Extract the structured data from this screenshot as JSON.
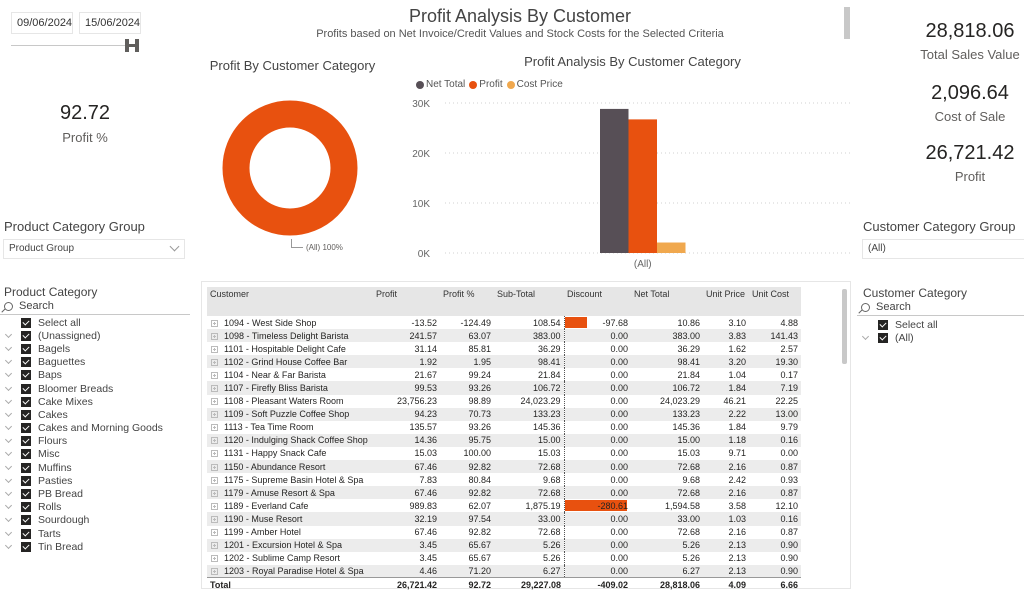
{
  "date_range": {
    "start": "09/06/2024",
    "end": "15/06/2024"
  },
  "header": {
    "title": "Profit Analysis By Customer",
    "subtitle": "Profits based on Net Invoice/Credit Values and Stock Costs for the Selected Criteria"
  },
  "kpis": {
    "profit_pct": {
      "value": "92.72",
      "label": "Profit %"
    },
    "total_sales": {
      "value": "28,818.06",
      "label": "Total Sales Value"
    },
    "cost_of_sale": {
      "value": "2,096.64",
      "label": "Cost of Sale"
    },
    "profit": {
      "value": "26,721.42",
      "label": "Profit"
    }
  },
  "colors": {
    "net_total": "#574f56",
    "profit": "#e8510f",
    "cost_price": "#f0a84e"
  },
  "donut": {
    "title": "Profit By Customer Category",
    "slices": [
      {
        "label": "(All)",
        "percent": 100
      }
    ],
    "label_text": "(All) 100%"
  },
  "chart_data": {
    "type": "bar",
    "title": "Profit Analysis By Customer Category",
    "categories": [
      "(All)"
    ],
    "series": [
      {
        "name": "Net Total",
        "values": [
          28818.06
        ]
      },
      {
        "name": "Profit",
        "values": [
          26721.42
        ]
      },
      {
        "name": "Cost Price",
        "values": [
          2096.64
        ]
      }
    ],
    "ylim": [
      0,
      30000
    ],
    "yticks": [
      "0K",
      "10K",
      "20K",
      "30K"
    ],
    "ytick_values": [
      0,
      10000,
      20000,
      30000
    ],
    "xlabel": "",
    "ylabel": "",
    "grid": true,
    "legend": "top-left"
  },
  "product_category_group": {
    "title": "Product Category Group",
    "selected": "Product Group"
  },
  "product_category": {
    "title": "Product Category",
    "search_placeholder": "Search",
    "select_all": "Select all",
    "items": [
      "(Unassigned)",
      "Bagels",
      "Baguettes",
      "Baps",
      "Bloomer Breads",
      "Cake Mixes",
      "Cakes",
      "Cakes and Morning Goods",
      "Flours",
      "Misc",
      "Muffins",
      "Pasties",
      "PB Bread",
      "Rolls",
      "Sourdough",
      "Tarts",
      "Tin Bread"
    ]
  },
  "customer_category_group": {
    "title": "Customer Category Group",
    "selected": "(All)"
  },
  "customer_category": {
    "title": "Customer Category",
    "search_placeholder": "Search",
    "select_all": "Select all",
    "items": [
      "(All)"
    ]
  },
  "table": {
    "columns": [
      "Customer",
      "Profit",
      "Profit %",
      "Sub-Total",
      "Discount",
      "Net Total",
      "Unit Price",
      "Unit Cost"
    ],
    "rows": [
      [
        "1094 - West Side Shop",
        "-13.52",
        "-124.49",
        "108.54",
        "-97.68",
        "10.86",
        "3.10",
        "4.88"
      ],
      [
        "1098 - Timeless Delight Barista",
        "241.57",
        "63.07",
        "383.00",
        "0.00",
        "383.00",
        "3.83",
        "141.43"
      ],
      [
        "1101 - Hospitable Delight Cafe",
        "31.14",
        "85.81",
        "36.29",
        "0.00",
        "36.29",
        "1.62",
        "2.57"
      ],
      [
        "1102 - Grind House Coffee Bar",
        "1.92",
        "1.95",
        "98.41",
        "0.00",
        "98.41",
        "3.20",
        "19.30"
      ],
      [
        "1104 - Near & Far Barista",
        "21.67",
        "99.24",
        "21.84",
        "0.00",
        "21.84",
        "1.04",
        "0.17"
      ],
      [
        "1107 - Firefly Bliss Barista",
        "99.53",
        "93.26",
        "106.72",
        "0.00",
        "106.72",
        "1.84",
        "7.19"
      ],
      [
        "1108 - Pleasant Waters Room",
        "23,756.23",
        "98.89",
        "24,023.29",
        "0.00",
        "24,023.29",
        "46.21",
        "22.25"
      ],
      [
        "1109 - Soft Puzzle Coffee Shop",
        "94.23",
        "70.73",
        "133.23",
        "0.00",
        "133.23",
        "2.22",
        "13.00"
      ],
      [
        "1113 - Tea Time Room",
        "135.57",
        "93.26",
        "145.36",
        "0.00",
        "145.36",
        "1.84",
        "9.79"
      ],
      [
        "1120 - Indulging Shack Coffee Shop",
        "14.36",
        "95.75",
        "15.00",
        "0.00",
        "15.00",
        "1.18",
        "0.16"
      ],
      [
        "1131 - Happy Snack Cafe",
        "15.03",
        "100.00",
        "15.03",
        "0.00",
        "15.03",
        "9.71",
        "0.00"
      ],
      [
        "1150 - Abundance Resort",
        "67.46",
        "92.82",
        "72.68",
        "0.00",
        "72.68",
        "2.16",
        "0.87"
      ],
      [
        "1175 - Supreme Basin Hotel & Spa",
        "7.83",
        "80.84",
        "9.68",
        "0.00",
        "9.68",
        "2.42",
        "0.93"
      ],
      [
        "1179 - Amuse Resort & Spa",
        "67.46",
        "92.82",
        "72.68",
        "0.00",
        "72.68",
        "2.16",
        "0.87"
      ],
      [
        "1189 - Everland Cafe",
        "989.83",
        "62.07",
        "1,875.19",
        "-280.61",
        "1,594.58",
        "3.58",
        "12.10"
      ],
      [
        "1190 - Muse Resort",
        "32.19",
        "97.54",
        "33.00",
        "0.00",
        "33.00",
        "1.03",
        "0.16"
      ],
      [
        "1199 - Amber Hotel",
        "67.46",
        "92.82",
        "72.68",
        "0.00",
        "72.68",
        "2.16",
        "0.87"
      ],
      [
        "1201 - Excursion Hotel & Spa",
        "3.45",
        "65.67",
        "5.26",
        "0.00",
        "5.26",
        "2.13",
        "0.90"
      ],
      [
        "1202 - Sublime Camp Resort",
        "3.45",
        "65.67",
        "5.26",
        "0.00",
        "5.26",
        "2.13",
        "0.90"
      ],
      [
        "1203 - Royal Paradise Hotel & Spa",
        "4.46",
        "71.20",
        "6.27",
        "0.00",
        "6.27",
        "2.13",
        "0.90"
      ]
    ],
    "discount_bars": {
      "1094 - West Side Shop": 97.68,
      "1189 - Everland Cafe": 280.61
    },
    "total": [
      "Total",
      "26,721.42",
      "92.72",
      "29,227.08",
      "-409.02",
      "28,818.06",
      "4.09",
      "6.66"
    ]
  }
}
